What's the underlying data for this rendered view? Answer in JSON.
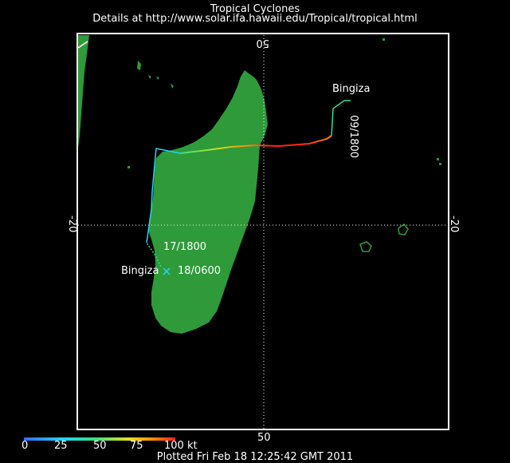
{
  "header": {
    "title": "Tropical Cyclones",
    "subtitle": "Details at http://www.solar.ifa.hawaii.edu/Tropical/tropical.html"
  },
  "axes": {
    "lon_label": "50",
    "lat_label_left": "-20",
    "lat_label_right": "-20",
    "lon_label_top": "50"
  },
  "storm": {
    "name_start": "Bingiza",
    "name_end": "Bingiza",
    "label_start": "09/1800",
    "label_mid": "17/1800",
    "label_end": "18/0600"
  },
  "legend": {
    "ticks": [
      "0",
      "25",
      "50",
      "75",
      "100 kt"
    ],
    "colors": [
      "#2f6bff",
      "#22d4ff",
      "#30e08a",
      "#e8e020",
      "#ff8a00",
      "#ff2020"
    ]
  },
  "footer": {
    "plotted": "Plotted Fri Feb 18 12:25:42 GMT 2011"
  },
  "colors": {
    "land": "#2e9a3a",
    "frame": "#ffffff",
    "background": "#000000"
  }
}
